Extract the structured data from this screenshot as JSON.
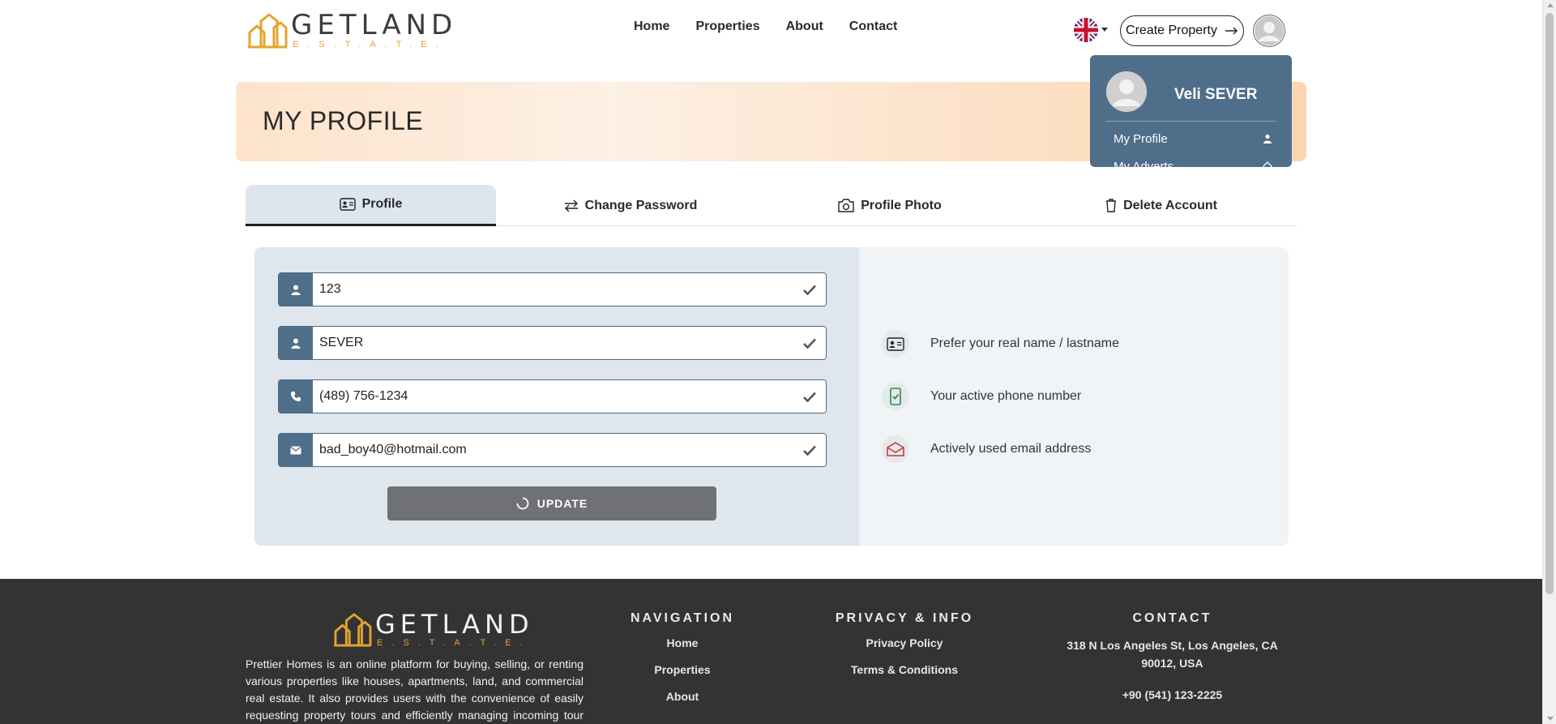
{
  "brand": {
    "name": "GETLAND",
    "tagline": "E.S.T.A.T.E.",
    "accent_color": "#e2a52b"
  },
  "nav": {
    "items": [
      {
        "label": "Home"
      },
      {
        "label": "Properties"
      },
      {
        "label": "About"
      },
      {
        "label": "Contact"
      }
    ]
  },
  "header": {
    "language_icon": "uk-flag-icon",
    "create_property_label": "Create Property",
    "create_property_icon": "arrow-right-icon",
    "avatar_icon": "user-avatar-icon"
  },
  "banner": {
    "title": "MY PROFILE"
  },
  "profile_menu": {
    "user_name": "Veli SEVER",
    "items": [
      {
        "label": "My Profile",
        "icon": "user-icon"
      },
      {
        "label": "My Adverts",
        "icon": "home-icon"
      }
    ]
  },
  "tabs": [
    {
      "label": "Profile",
      "icon": "id-card-icon",
      "active": true
    },
    {
      "label": "Change Password",
      "icon": "swap-icon",
      "active": false
    },
    {
      "label": "Profile Photo",
      "icon": "camera-icon",
      "active": false
    },
    {
      "label": "Delete Account",
      "icon": "trash-icon",
      "active": false
    }
  ],
  "form": {
    "first_name": "123",
    "last_name": "SEVER",
    "phone": "(489) 756-1234",
    "email": "bad_boy40@hotmail.com",
    "update_label": "UPDATE"
  },
  "hints": [
    {
      "text": "Prefer your real name / lastname",
      "icon": "id-card-icon"
    },
    {
      "text": "Your active phone number",
      "icon": "phone-check-icon"
    },
    {
      "text": "Actively used email address",
      "icon": "envelope-open-icon"
    }
  ],
  "footer": {
    "description": "Prettier Homes is an online platform for buying, selling, or renting various properties like houses, apartments, land, and commercial real estate. It also provides users with the convenience of easily requesting property tours and efficiently managing incoming tour requests, thereby offering a",
    "navigation": {
      "title": "NAVIGATION",
      "links": [
        "Home",
        "Properties",
        "About"
      ]
    },
    "privacy": {
      "title": "PRIVACY & INFO",
      "links": [
        "Privacy Policy",
        "Terms & Conditions"
      ]
    },
    "contact": {
      "title": "CONTACT",
      "address": "318 N Los Angeles St, Los Angeles, CA 90012, USA",
      "phone": "+90 (541) 123-2225"
    }
  }
}
